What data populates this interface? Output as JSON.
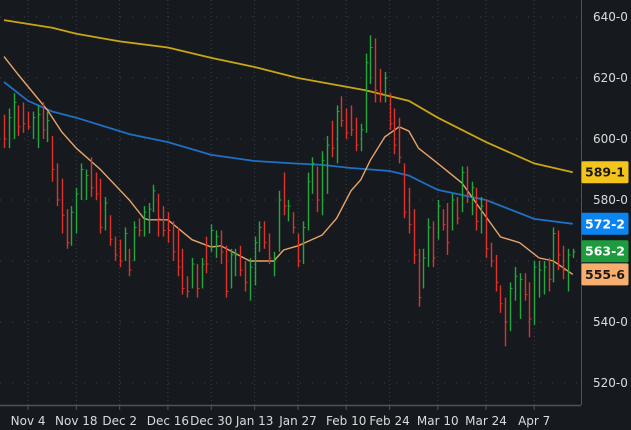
{
  "chart_data": {
    "type": "ohlc",
    "ylim": [
      512,
      646
    ],
    "grid": true,
    "y_ticks": [
      "640-0",
      "620-0",
      "600-0",
      "580-0",
      "540-0",
      "520-0"
    ],
    "y_tick_values": [
      640,
      620,
      600,
      580,
      540,
      520
    ],
    "x_ticks": [
      {
        "label": "Nov 4",
        "bar": 5
      },
      {
        "label": "Nov 18",
        "bar": 15
      },
      {
        "label": "Dec 2",
        "bar": 24
      },
      {
        "label": "Dec 16",
        "bar": 34
      },
      {
        "label": "Dec 30",
        "bar": 43
      },
      {
        "label": "Jan 13",
        "bar": 52
      },
      {
        "label": "Jan 27",
        "bar": 61
      },
      {
        "label": "Feb 10",
        "bar": 71
      },
      {
        "label": "Feb 24",
        "bar": 80
      },
      {
        "label": "Mar 10",
        "bar": 90
      },
      {
        "label": "Mar 24",
        "bar": 100
      },
      {
        "label": "Apr 7",
        "bar": 110
      }
    ],
    "bars_ohlc": [
      [
        606,
        608,
        597,
        600
      ],
      [
        600,
        610,
        597,
        607
      ],
      [
        603,
        615,
        600,
        612
      ],
      [
        609,
        611,
        601,
        604
      ],
      [
        610,
        612,
        602,
        605
      ],
      [
        608,
        609,
        603,
        604
      ],
      [
        602,
        609,
        600,
        607
      ],
      [
        600,
        611,
        597,
        608
      ],
      [
        610,
        612,
        600,
        603
      ],
      [
        601,
        609,
        599,
        606
      ],
      [
        600,
        601,
        586,
        590
      ],
      [
        590,
        592,
        578,
        580
      ],
      [
        585,
        587,
        569,
        575
      ],
      [
        575,
        577,
        564,
        566
      ],
      [
        567,
        578,
        565,
        576
      ],
      [
        571,
        584,
        569,
        582
      ],
      [
        582,
        592,
        580,
        590
      ],
      [
        583,
        590,
        580,
        588
      ],
      [
        592,
        594,
        581,
        584
      ],
      [
        588,
        589,
        580,
        582
      ],
      [
        585,
        587,
        569,
        571
      ],
      [
        572,
        581,
        570,
        579
      ],
      [
        574,
        575,
        565,
        567
      ],
      [
        567,
        568,
        560,
        562
      ],
      [
        566,
        567,
        558,
        560
      ],
      [
        561,
        571,
        560,
        569
      ],
      [
        563,
        564,
        555,
        557
      ],
      [
        561,
        573,
        560,
        571
      ],
      [
        573,
        574,
        568,
        570
      ],
      [
        569,
        578,
        568,
        576
      ],
      [
        571,
        579,
        569,
        577
      ],
      [
        577,
        585,
        576,
        583
      ],
      [
        580,
        582,
        568,
        574
      ],
      [
        577,
        578,
        568,
        570
      ],
      [
        575,
        576,
        566,
        570
      ],
      [
        572,
        573,
        560,
        563
      ],
      [
        569,
        571,
        555,
        558
      ],
      [
        562,
        564,
        549,
        551
      ],
      [
        554,
        555,
        548,
        550
      ],
      [
        552,
        561,
        551,
        559
      ],
      [
        558,
        559,
        548,
        551
      ],
      [
        552,
        561,
        551,
        559
      ],
      [
        566,
        568,
        556,
        559
      ],
      [
        564,
        572,
        563,
        570
      ],
      [
        562,
        570,
        561,
        568
      ],
      [
        569,
        570,
        559,
        563
      ],
      [
        563,
        565,
        548,
        550
      ],
      [
        552,
        564,
        551,
        562
      ],
      [
        556,
        564,
        555,
        562
      ],
      [
        564,
        565,
        555,
        557
      ],
      [
        559,
        560,
        550,
        553
      ],
      [
        549,
        561,
        547,
        558
      ],
      [
        554,
        568,
        552,
        566
      ],
      [
        564,
        573,
        563,
        571
      ],
      [
        572,
        573,
        564,
        566
      ],
      [
        568,
        569,
        559,
        561
      ],
      [
        556,
        563,
        555,
        561
      ],
      [
        565,
        583,
        563,
        580
      ],
      [
        587,
        589,
        575,
        578
      ],
      [
        574,
        580,
        573,
        578
      ],
      [
        575,
        576,
        569,
        571
      ],
      [
        567,
        569,
        558,
        560
      ],
      [
        561,
        573,
        559,
        571
      ],
      [
        572,
        589,
        570,
        586
      ],
      [
        584,
        594,
        582,
        592
      ],
      [
        590,
        591,
        576,
        580
      ],
      [
        578,
        596,
        575,
        593
      ],
      [
        585,
        601,
        582,
        598
      ],
      [
        605,
        606,
        594,
        597
      ],
      [
        595,
        611,
        592,
        609
      ],
      [
        613,
        614,
        604,
        606
      ],
      [
        609,
        610,
        600,
        602
      ],
      [
        610,
        611,
        601,
        603
      ],
      [
        606,
        607,
        596,
        598
      ],
      [
        597,
        605,
        596,
        603
      ],
      [
        604,
        628,
        602,
        625
      ],
      [
        620,
        634,
        618,
        630
      ],
      [
        631,
        633,
        612,
        616
      ],
      [
        622,
        623,
        612,
        615
      ],
      [
        613,
        622,
        612,
        620
      ],
      [
        614,
        615,
        603,
        605
      ],
      [
        608,
        610,
        595,
        598
      ],
      [
        606,
        607,
        592,
        594
      ],
      [
        590,
        592,
        574,
        576
      ],
      [
        582,
        584,
        569,
        572
      ],
      [
        576,
        577,
        559,
        562
      ],
      [
        562,
        564,
        545,
        548
      ],
      [
        552,
        564,
        551,
        561
      ],
      [
        560,
        574,
        558,
        571
      ],
      [
        572,
        573,
        558,
        561
      ],
      [
        568,
        580,
        567,
        578
      ],
      [
        576,
        577,
        570,
        572
      ],
      [
        578,
        579,
        562,
        566
      ],
      [
        571,
        582,
        570,
        580
      ],
      [
        580,
        581,
        572,
        574
      ],
      [
        578,
        591,
        576,
        589
      ],
      [
        590,
        591,
        579,
        582
      ],
      [
        576,
        586,
        575,
        584
      ],
      [
        583,
        584,
        570,
        573
      ],
      [
        570,
        581,
        569,
        578
      ],
      [
        579,
        580,
        561,
        564
      ],
      [
        565,
        566,
        558,
        560
      ],
      [
        561,
        562,
        550,
        553
      ],
      [
        551,
        552,
        543,
        546
      ],
      [
        547,
        548,
        532,
        540
      ],
      [
        539,
        553,
        537,
        551
      ],
      [
        548,
        558,
        547,
        555
      ],
      [
        543,
        556,
        541,
        554
      ],
      [
        555,
        556,
        547,
        549
      ],
      [
        552,
        553,
        535,
        541
      ],
      [
        541,
        560,
        539,
        558
      ],
      [
        549,
        560,
        548,
        557
      ],
      [
        550,
        560,
        549,
        558
      ],
      [
        560,
        561,
        550,
        554
      ],
      [
        555,
        571,
        553,
        569
      ],
      [
        569,
        570,
        557,
        562
      ],
      [
        564,
        565,
        554,
        557
      ],
      [
        551,
        564,
        550,
        562
      ],
      [
        561,
        564,
        561,
        563
      ]
    ],
    "series": [
      {
        "color": "#c9a516",
        "last_label": "589-1",
        "points": [
          [
            0,
            639
          ],
          [
            10,
            636.5
          ],
          [
            15,
            634.5
          ],
          [
            24,
            632
          ],
          [
            34,
            630
          ],
          [
            43,
            626.6
          ],
          [
            52,
            623.6
          ],
          [
            61,
            620
          ],
          [
            75,
            616
          ],
          [
            84,
            612.5
          ],
          [
            90,
            607
          ],
          [
            100,
            599
          ],
          [
            110,
            592
          ],
          [
            118,
            589.1
          ]
        ]
      },
      {
        "color": "#1f6fc4",
        "last_label": "572-2",
        "points": [
          [
            0,
            618.7
          ],
          [
            5,
            612.5
          ],
          [
            10,
            609
          ],
          [
            15,
            607
          ],
          [
            26,
            601.6
          ],
          [
            34,
            599
          ],
          [
            43,
            594.8
          ],
          [
            52,
            592.8
          ],
          [
            60,
            592
          ],
          [
            66,
            591.5
          ],
          [
            72,
            590.5
          ],
          [
            80,
            589.5
          ],
          [
            84,
            588
          ],
          [
            90,
            583.3
          ],
          [
            100,
            580
          ],
          [
            110,
            573.8
          ],
          [
            118,
            572.2
          ]
        ]
      },
      {
        "color": "#e8a468",
        "last_label": "555-6",
        "points": [
          [
            0,
            627
          ],
          [
            3,
            621
          ],
          [
            9,
            609.5
          ],
          [
            12,
            602.3
          ],
          [
            15,
            597
          ],
          [
            20,
            590
          ],
          [
            26,
            580
          ],
          [
            29,
            574
          ],
          [
            30,
            573.5
          ],
          [
            34,
            573.5
          ],
          [
            39,
            567
          ],
          [
            43,
            564.6
          ],
          [
            45,
            565
          ],
          [
            51,
            560
          ],
          [
            56,
            560
          ],
          [
            58,
            563.6
          ],
          [
            61,
            565
          ],
          [
            66,
            568.5
          ],
          [
            69,
            574
          ],
          [
            72,
            583
          ],
          [
            74,
            586.6
          ],
          [
            76,
            593
          ],
          [
            79,
            600.7
          ],
          [
            82,
            604
          ],
          [
            84,
            602.6
          ],
          [
            86,
            597
          ],
          [
            90,
            592
          ],
          [
            95,
            585.6
          ],
          [
            99,
            576.7
          ],
          [
            103,
            567.9
          ],
          [
            107,
            566
          ],
          [
            111,
            561
          ],
          [
            114,
            560
          ],
          [
            118,
            555.6
          ]
        ]
      }
    ],
    "price_tags": [
      {
        "label": "589-1",
        "value": 589.1,
        "bg": "#f2c41c",
        "fg": "#1a1a1a"
      },
      {
        "label": "572-2",
        "value": 572.2,
        "bg": "#0a84f0",
        "fg": "#ffffff"
      },
      {
        "label": "563-2",
        "value": 563.2,
        "bg": "#1e9b3c",
        "fg": "#ffffff"
      },
      {
        "label": "555-6",
        "value": 555.6,
        "bg": "#f7ae6e",
        "fg": "#1a1a1a"
      }
    ],
    "colors": {
      "up": "#22a83f",
      "down": "#e0312b",
      "background": "#161a1e",
      "grid": "#3b434b",
      "axis": "#4b545c"
    }
  }
}
